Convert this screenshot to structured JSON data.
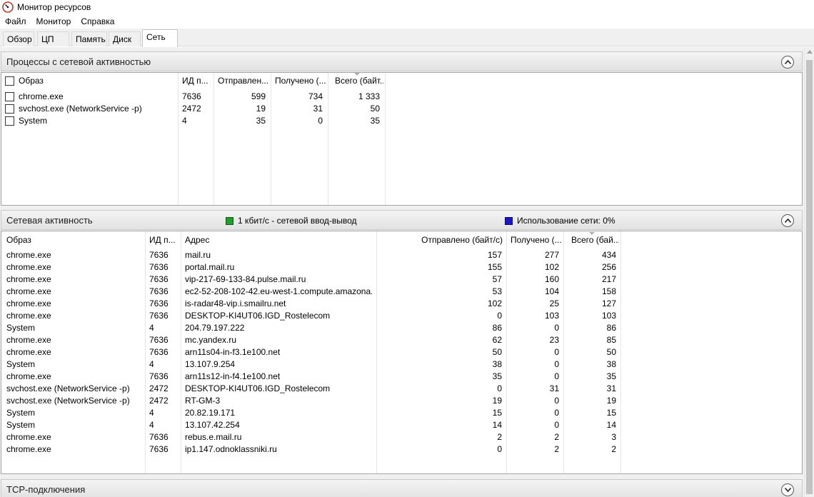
{
  "window": {
    "title": "Монитор ресурсов"
  },
  "menu": [
    "Файл",
    "Монитор",
    "Справка"
  ],
  "tabs": [
    {
      "label": "Обзор",
      "active": false
    },
    {
      "label": "ЦП",
      "active": false
    },
    {
      "label": "Память",
      "active": false
    },
    {
      "label": "Диск",
      "active": false
    },
    {
      "label": "Сеть",
      "active": true
    }
  ],
  "processes": {
    "title": "Процессы с сетевой активностью",
    "columns": [
      "Образ",
      "ИД п...",
      "Отправлен...",
      "Получено (...",
      "Всего (байт..."
    ],
    "rows": [
      [
        "chrome.exe",
        "7636",
        "599",
        "734",
        "1 333"
      ],
      [
        "svchost.exe (NetworkService -p)",
        "2472",
        "19",
        "31",
        "50"
      ],
      [
        "System",
        "4",
        "35",
        "0",
        "35"
      ]
    ]
  },
  "network": {
    "title": "Сетевая активность",
    "legend_io": "1 кбит/с - сетевой ввод-вывод",
    "legend_usage": "Использование сети: 0%",
    "colors": {
      "io": "#1f9e2c",
      "usage": "#1a16c9"
    },
    "columns": [
      "Образ",
      "ИД п...",
      "Адрес",
      "Отправлено (байт/с)",
      "Получено (...",
      "Всего (бай..."
    ],
    "rows": [
      [
        "chrome.exe",
        "7636",
        "mail.ru",
        "157",
        "277",
        "434"
      ],
      [
        "chrome.exe",
        "7636",
        "portal.mail.ru",
        "155",
        "102",
        "256"
      ],
      [
        "chrome.exe",
        "7636",
        "vip-217-69-133-84.pulse.mail.ru",
        "57",
        "160",
        "217"
      ],
      [
        "chrome.exe",
        "7636",
        "ec2-52-208-102-42.eu-west-1.compute.amazona...",
        "53",
        "104",
        "158"
      ],
      [
        "chrome.exe",
        "7636",
        "is-radar48-vip.i.smailru.net",
        "102",
        "25",
        "127"
      ],
      [
        "chrome.exe",
        "7636",
        "DESKTOP-KI4UT06.IGD_Rostelecom",
        "0",
        "103",
        "103"
      ],
      [
        "System",
        "4",
        "204.79.197.222",
        "86",
        "0",
        "86"
      ],
      [
        "chrome.exe",
        "7636",
        "mc.yandex.ru",
        "62",
        "23",
        "85"
      ],
      [
        "chrome.exe",
        "7636",
        "arn11s04-in-f3.1e100.net",
        "50",
        "0",
        "50"
      ],
      [
        "System",
        "4",
        "13.107.9.254",
        "38",
        "0",
        "38"
      ],
      [
        "chrome.exe",
        "7636",
        "arn11s12-in-f4.1e100.net",
        "35",
        "0",
        "35"
      ],
      [
        "svchost.exe (NetworkService -p)",
        "2472",
        "DESKTOP-KI4UT06.IGD_Rostelecom",
        "0",
        "31",
        "31"
      ],
      [
        "svchost.exe (NetworkService -p)",
        "2472",
        "RT-GM-3",
        "19",
        "0",
        "19"
      ],
      [
        "System",
        "4",
        "20.82.19.171",
        "15",
        "0",
        "15"
      ],
      [
        "System",
        "4",
        "13.107.42.254",
        "14",
        "0",
        "14"
      ],
      [
        "chrome.exe",
        "7636",
        "rebus.e.mail.ru",
        "2",
        "2",
        "3"
      ],
      [
        "chrome.exe",
        "7636",
        "ip1.147.odnoklassniki.ru",
        "0",
        "2",
        "2"
      ]
    ]
  },
  "tcp": {
    "title": "TCP-подключения"
  }
}
